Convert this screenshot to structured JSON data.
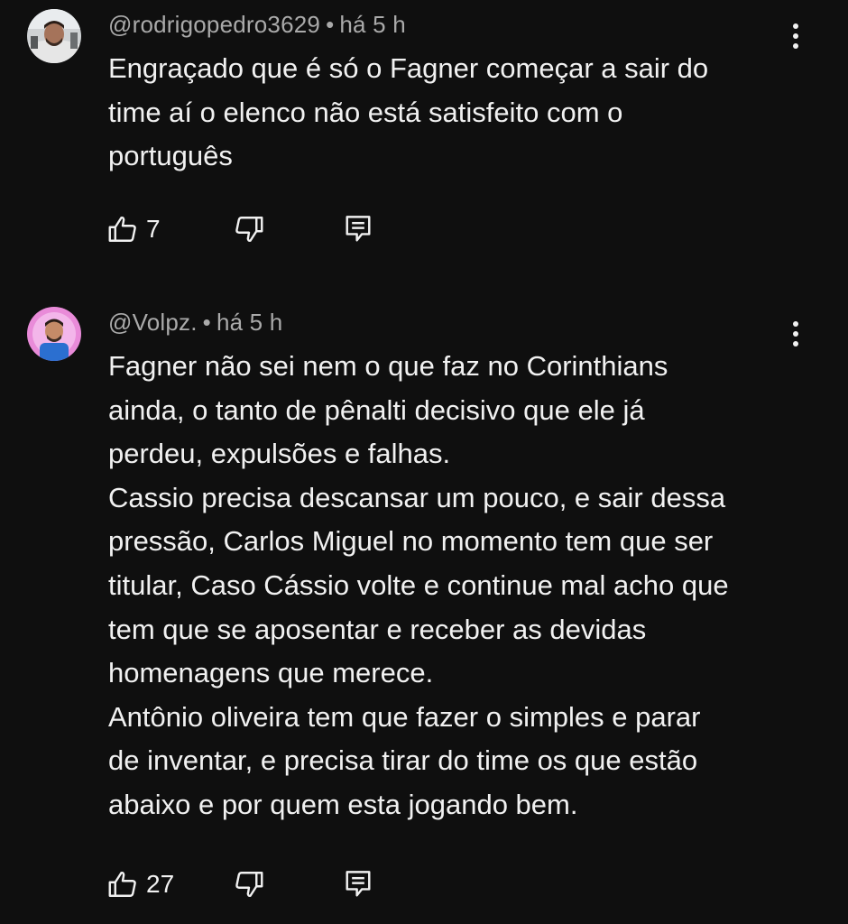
{
  "comments": [
    {
      "handle": "@rodrigopedro3629",
      "separator": "•",
      "time": "há 5 h",
      "text": "Engraçado que é só o Fagner começar a sair do\ntime aí o elenco não está satisfeito com o\nportuguês",
      "likes": "7",
      "avatar_icon": "user-avatar-photo"
    },
    {
      "handle": "@Volpz.",
      "separator": "•",
      "time": "há 5 h",
      "text": "Fagner não sei nem o que faz no Corinthians\nainda, o tanto de pênalti decisivo que ele já\nperdeu, expulsões e falhas.\nCassio precisa descansar um pouco, e sair dessa\npressão, Carlos Miguel no momento tem que ser\ntitular, Caso Cássio volte e continue mal acho que\ntem que se aposentar e receber as devidas\nhomenagens que merece.\nAntônio oliveira tem que fazer o simples e parar\nde inventar, e precisa tirar do time os que estão\nabaixo e por quem esta jogando bem.",
      "likes": "27",
      "avatar_icon": "user-avatar-photo"
    }
  ],
  "icons": {
    "like": "thumbs-up-icon",
    "dislike": "thumbs-down-icon",
    "reply": "reply-comment-icon",
    "more": "more-vertical-icon"
  },
  "colors": {
    "background": "#0f0f0f",
    "text": "#f1f1f1",
    "meta": "#aaaaaa"
  }
}
